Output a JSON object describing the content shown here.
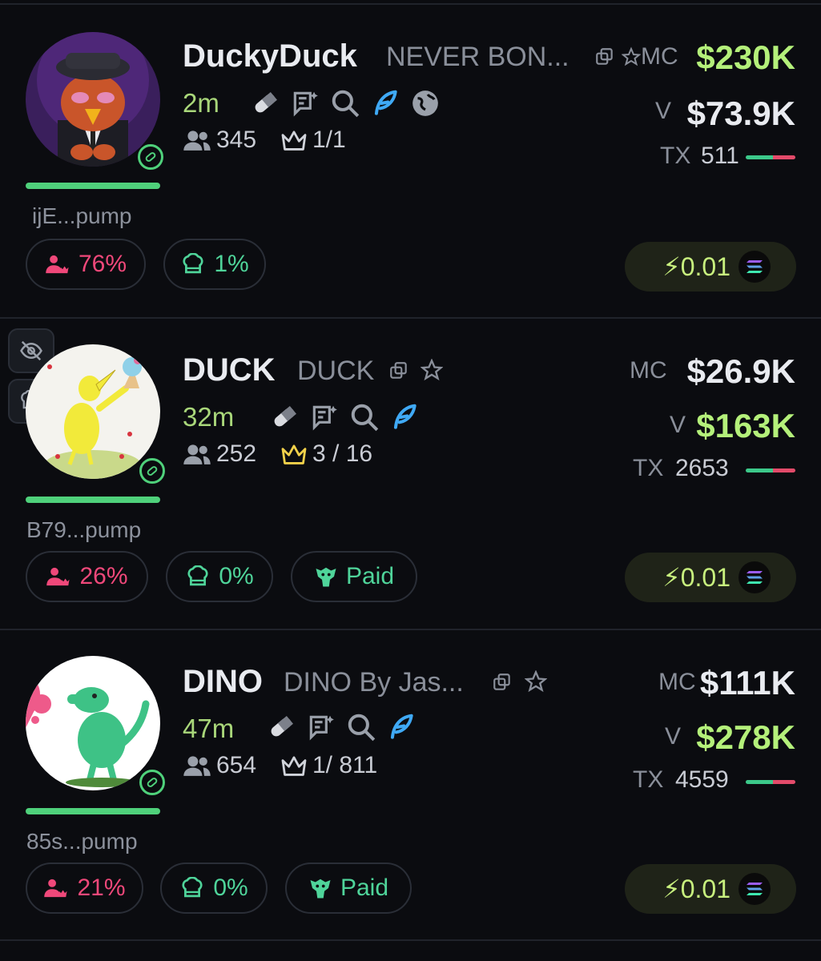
{
  "tokens": [
    {
      "name": "DuckyDuck",
      "subtitle": "NEVER BON...",
      "age": "2m",
      "holders": "345",
      "top": "1/1",
      "address": "ijE...pump",
      "mc_label": "MC",
      "mc": "$230K",
      "v_label": "V",
      "v": "$73.9K",
      "tx_label": "TX",
      "tx": "511",
      "holders_pct": "76%",
      "dev_pct": "1%",
      "buy": "0.01"
    },
    {
      "name": "DUCK",
      "subtitle": "DUCK",
      "age": "32m",
      "holders": "252",
      "top": "3 / 16",
      "address": "B79...pump",
      "mc_label": "MC",
      "mc": "$26.9K",
      "v_label": "V",
      "v": "$163K",
      "tx_label": "TX",
      "tx": "2653",
      "holders_pct": "26%",
      "dev_pct": "0%",
      "paid": "Paid",
      "buy": "0.01"
    },
    {
      "name": "DINO",
      "subtitle": "DINO By Jas...",
      "age": "47m",
      "holders": "654",
      "top": "1/ 811",
      "address": "85s...pump",
      "mc_label": "MC",
      "mc": "$111K",
      "v_label": "V",
      "v": "$278K",
      "tx_label": "TX",
      "tx": "4559",
      "holders_pct": "21%",
      "dev_pct": "0%",
      "paid": "Paid",
      "buy": "0.01"
    }
  ],
  "colors": {
    "background": "#0b0c10",
    "accent_green": "#b4f07a",
    "progress_green": "#4fd17b",
    "pink": "#f0487a",
    "teal": "#4fd49a",
    "twitter_blue": "#3fa9f5",
    "crown_gold": "#f2d14a"
  }
}
